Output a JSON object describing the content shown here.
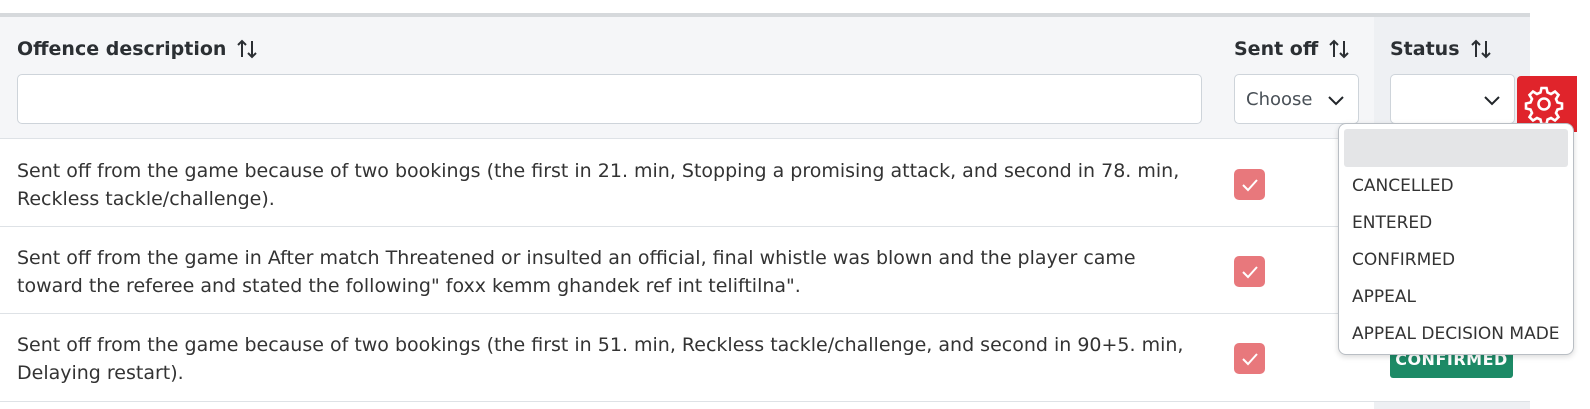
{
  "table": {
    "columns": {
      "offence_description": "Offence description",
      "sent_off": "Sent off",
      "status": "Status"
    },
    "filters": {
      "offence_description_value": "",
      "sent_off_value": "Choose",
      "status_value": ""
    },
    "rows": [
      {
        "description": "Sent off from the game because of two bookings (the first in 21. min, Stopping a promising attack, and second in 78. min, Reckless tackle/challenge).",
        "sent_off": true
      },
      {
        "description": "Sent off from the game in After match Threatened or insulted an official, final whistle was blown and the player came toward the referee and stated the following\" foxx kemm ghandek ref int teliftilna\".",
        "sent_off": true
      },
      {
        "description": "Sent off from the game because of two bookings (the first in 51. min, Reckless tackle/challenge, and second in 90+5. min, Delaying restart).",
        "sent_off": true,
        "status": "CONFIRMED"
      }
    ]
  },
  "status_dropdown": {
    "options": [
      "",
      "CANCELLED",
      "ENTERED",
      "CONFIRMED",
      "APPEAL",
      "APPEAL DECISION MADE"
    ]
  },
  "icons": {
    "sort": "sort-arrows-icon",
    "chevron": "chevron-down-icon",
    "settings": "gear-icon",
    "check": "checkmark-icon"
  },
  "colors": {
    "gear_button": "#e0242b",
    "checkbox": "#e8787c",
    "confirmed_badge": "#1d8a66"
  }
}
